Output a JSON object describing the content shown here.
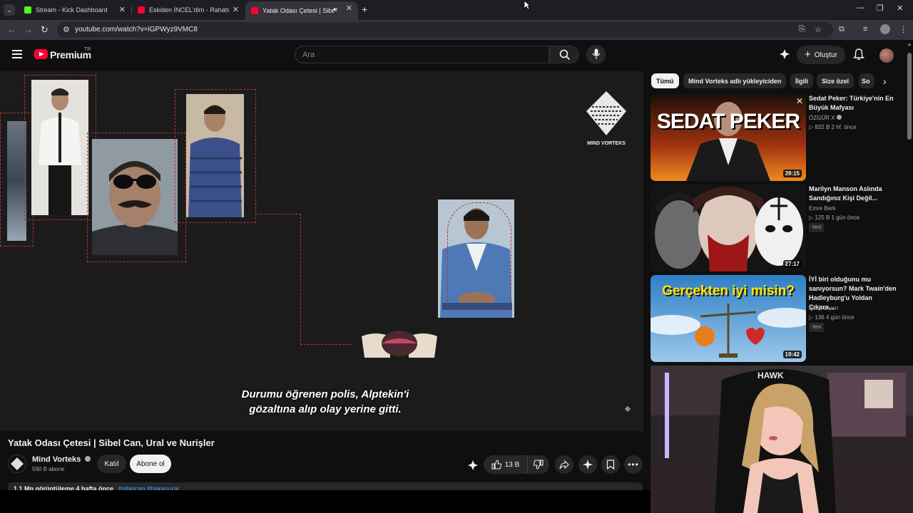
{
  "browser": {
    "tabs": [
      {
        "label": "Stream - Kick Dashboard",
        "active": false
      },
      {
        "label": "Eskiden İNCEL'dim - Rahatsız Ed",
        "active": false
      },
      {
        "label": "Yatak Odası Çetesi | Sibel C",
        "active": true
      }
    ],
    "new_tab": "+",
    "url": "youtube.com/watch?v=iGPWyz9VMC8"
  },
  "header": {
    "logo": "Premium",
    "logo_region": "TR",
    "search_placeholder": "Ara",
    "create_label": "Oluştur"
  },
  "video": {
    "subtitle_line1": "Durumu öğrenen polis, Alptekin'i",
    "subtitle_line2": "gözaltına alıp olay yerine gitti.",
    "watermark_name": "MIND VORTEKS",
    "title": "Yatak Odası Çetesi | Sibel Can, Ural ve Nurişler",
    "channel": "Mind Vorteks",
    "subscribers": "590 B abone",
    "join_label": "Katıl",
    "subscribe_label": "Abone ol",
    "likes": "13 B",
    "description_stats": "1,1 Mn görüntüleme  4 hafta önce",
    "description_tags": "#sibelcan #hakanural"
  },
  "chips": [
    {
      "label": "Tümü",
      "active": true
    },
    {
      "label": "Mind Vorteks adlı yükleyiciden",
      "active": false
    },
    {
      "label": "İlgili",
      "active": false
    },
    {
      "label": "Size özel",
      "active": false
    },
    {
      "label": "So",
      "active": false
    }
  ],
  "recommendations": [
    {
      "title": "Sedat Peker: Türkiye'nin En Büyük Mafyası",
      "channel": "ÖZGÜR X",
      "meta": "832 B  2 hf. önce",
      "duration": "39:15",
      "thumb_text": "SEDAT PEKER",
      "badge": ""
    },
    {
      "title": "Marilyn Manson Aslında Sandığınız Kişi Değil...",
      "channel": "Emre Berk",
      "meta": "125 B  1 gün önce",
      "duration": "27:17",
      "thumb_text": "",
      "badge": "Yeni"
    },
    {
      "title": "İYİ biri olduğunu mu sanıyorsun? Mark Twain'den Hadleyburg'u Yoldan Çıkara...",
      "channel": "Kitap Diyarı",
      "meta": "136  4 gün önce",
      "duration": "19:42",
      "thumb_text": "Gerçekten iyi misin?",
      "badge": "Yeni"
    }
  ],
  "colors": {
    "youtube_red": "#ff0033",
    "link_blue": "#3ea6ff",
    "frame_red": "#b3343c"
  }
}
